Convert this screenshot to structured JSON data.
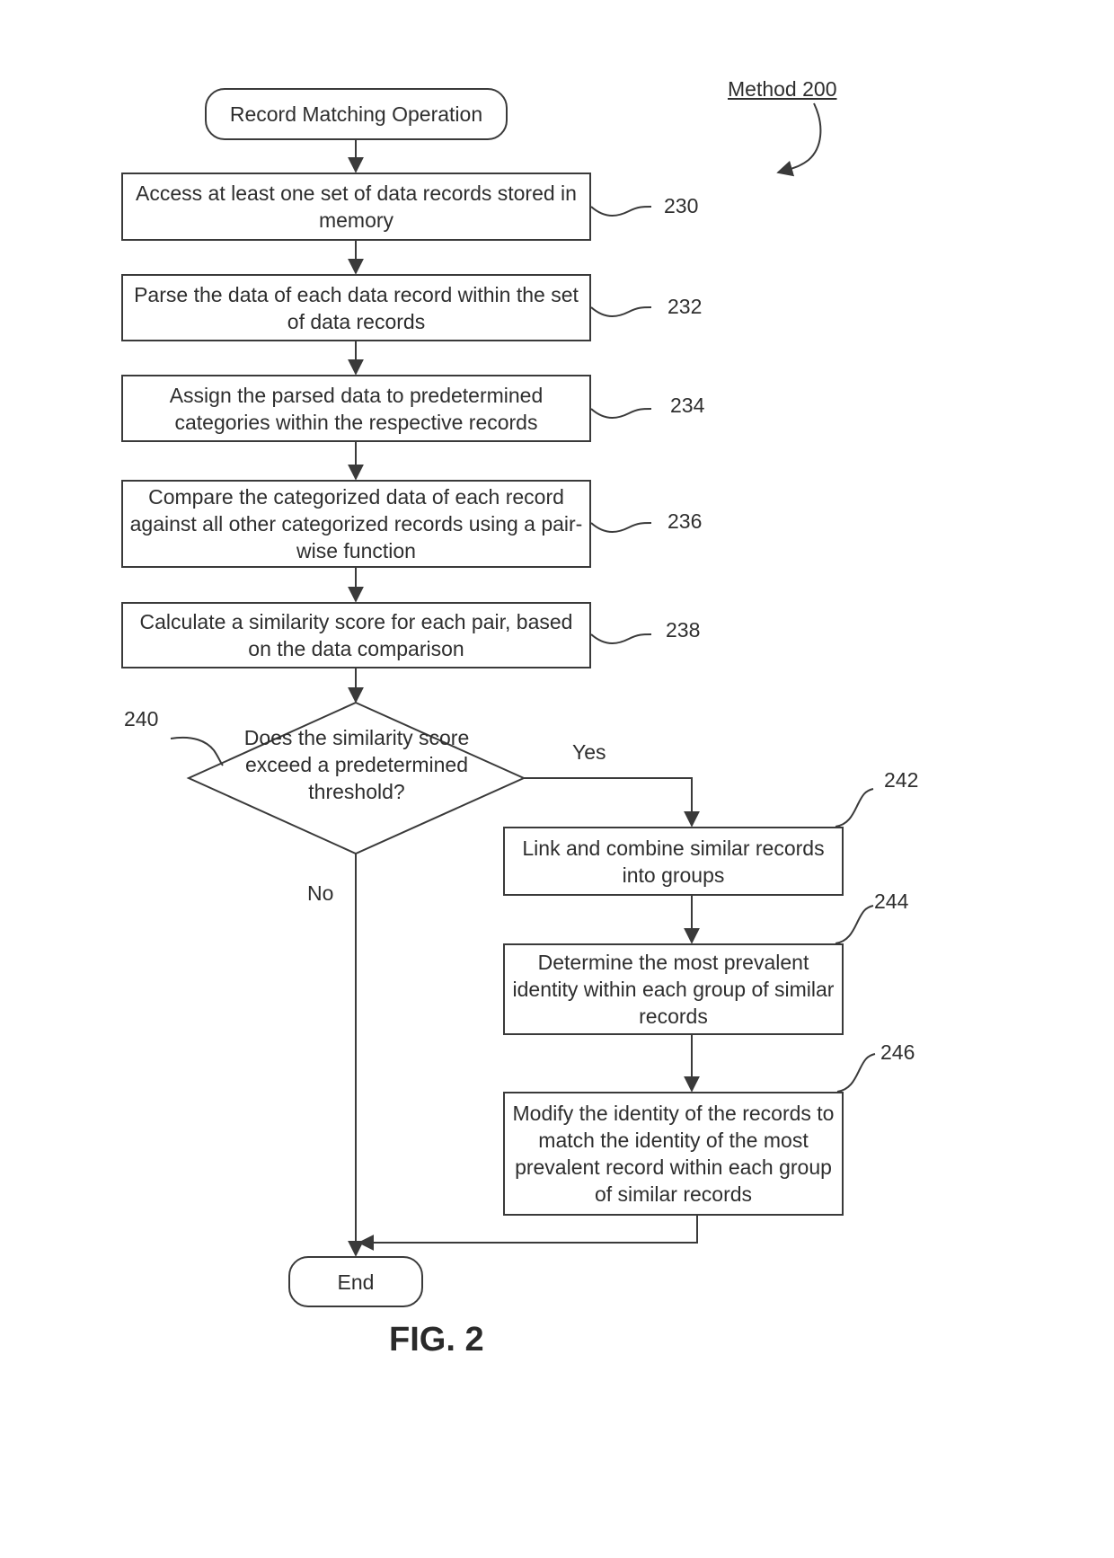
{
  "method_label": "Method 200",
  "figure_label": "FIG. 2",
  "start": {
    "text": "Record Matching Operation"
  },
  "end": {
    "text": "End"
  },
  "steps": [
    {
      "ref": "230",
      "text": "Access at least one set of data records stored in memory"
    },
    {
      "ref": "232",
      "text": "Parse the data of each data record within the set of data records"
    },
    {
      "ref": "234",
      "text": "Assign the parsed data to predetermined categories within the respective records"
    },
    {
      "ref": "236",
      "text": "Compare the categorized data of each record against all other categorized records using a pair-wise function"
    },
    {
      "ref": "238",
      "text": "Calculate a similarity score for each pair, based on the data comparison"
    },
    {
      "ref": "242",
      "text": "Link and combine similar records into groups"
    },
    {
      "ref": "244",
      "text": "Determine the most prevalent identity within each group of similar records"
    },
    {
      "ref": "246",
      "text": "Modify the identity of the records to match the identity of the most prevalent record within each group of similar records"
    }
  ],
  "decision": {
    "ref": "240",
    "text": "Does the similarity score exceed a predetermined threshold?",
    "yes_label": "Yes",
    "no_label": "No"
  }
}
